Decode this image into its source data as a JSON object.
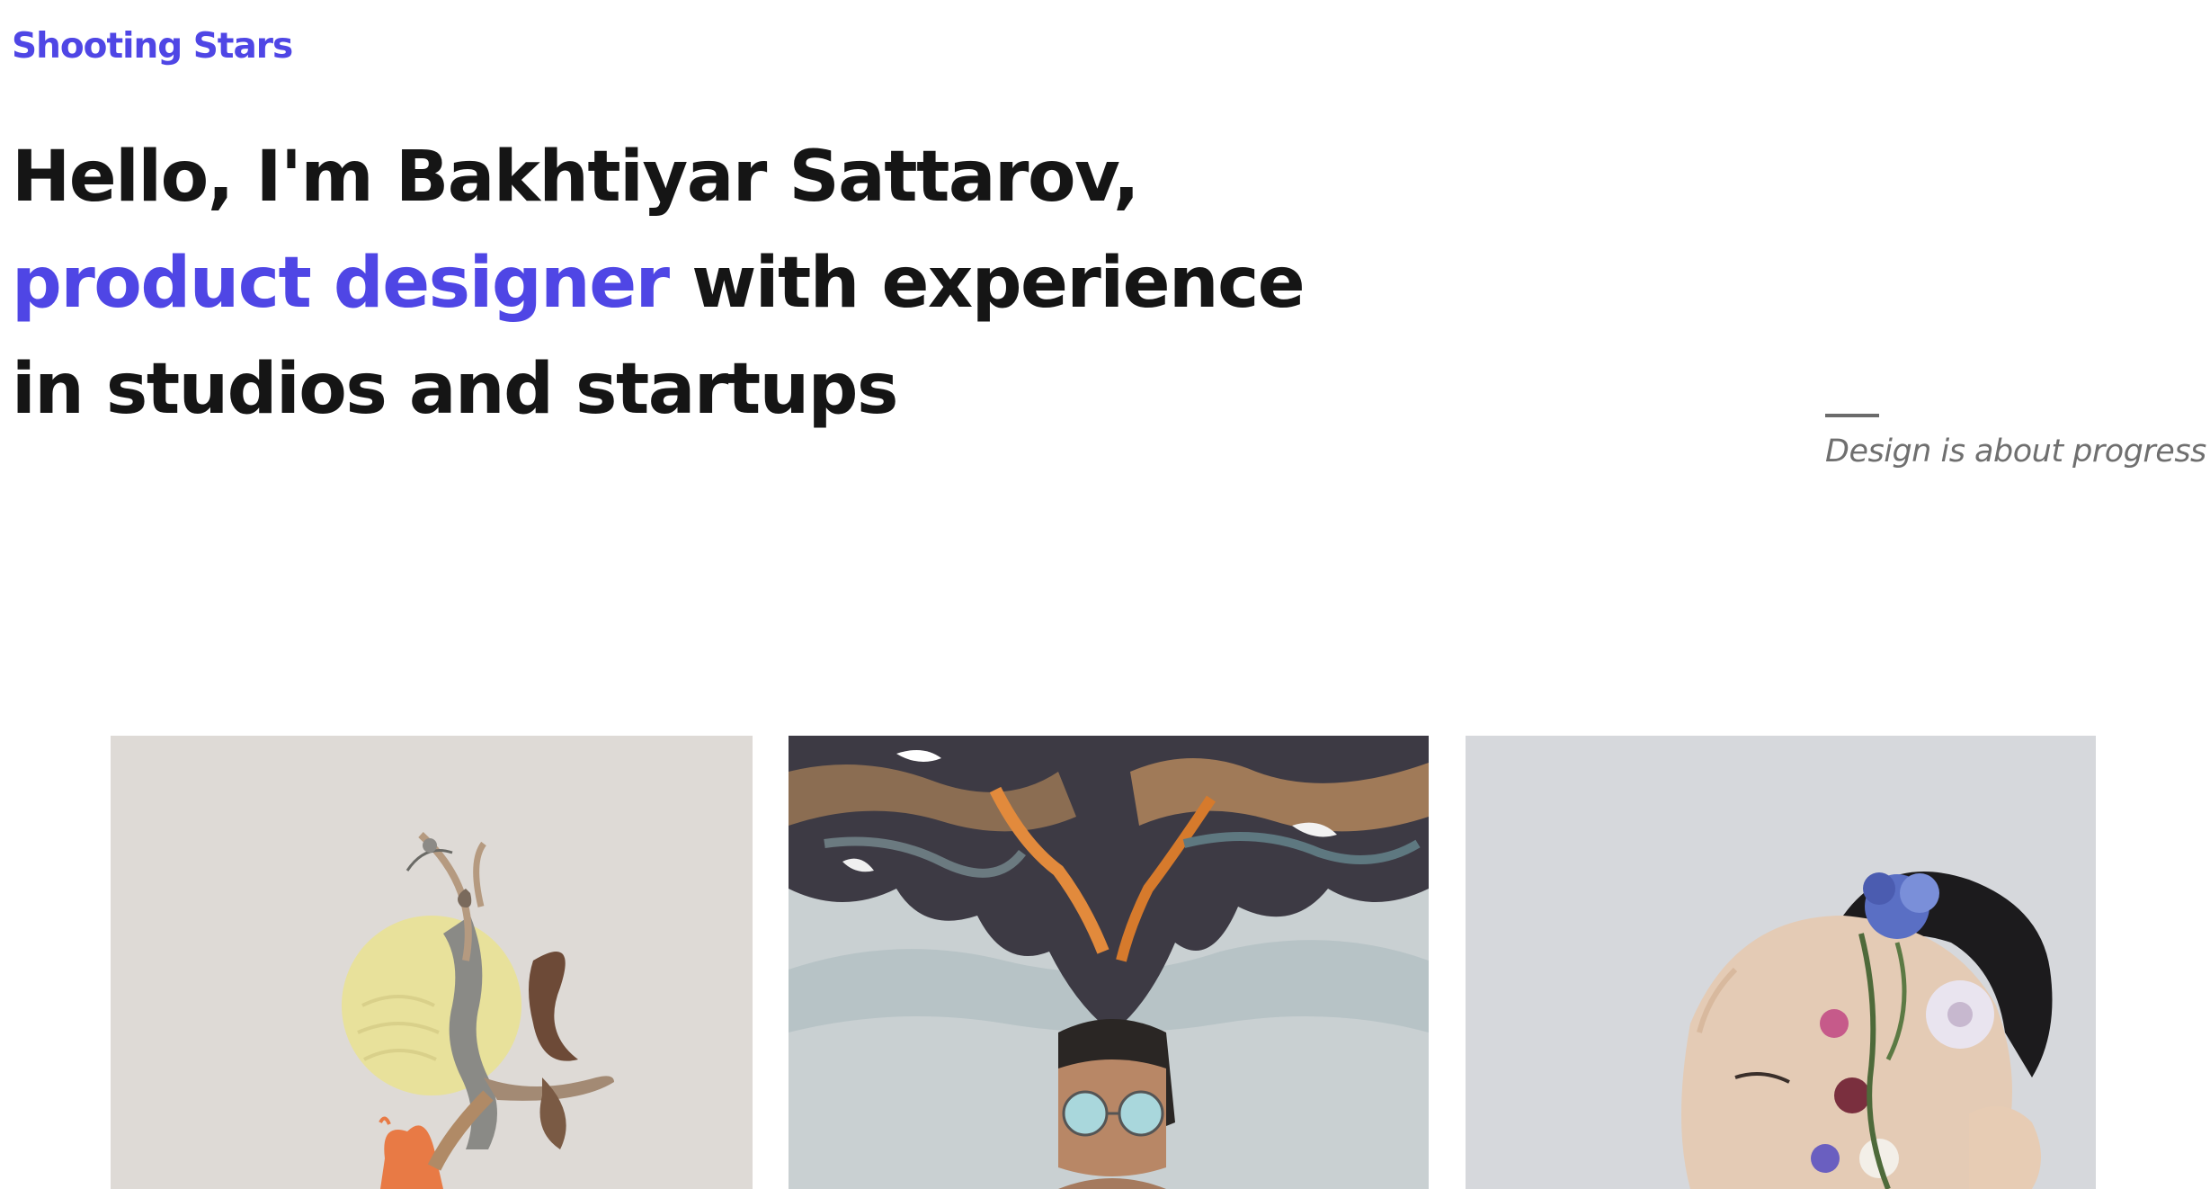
{
  "brand": {
    "name": "Shooting Stars"
  },
  "hero": {
    "line1": "Hello, I'm Bakhtiyar Sattarov,",
    "line2_accent": "product designer",
    "line2_rest": " with experience",
    "line3": "in studios and startups"
  },
  "tagline": {
    "text": "Design is about progress"
  },
  "colors": {
    "accent": "#4f46e5",
    "heading": "#151515",
    "muted": "#6f6f6f"
  },
  "portfolio": {
    "items": [
      {
        "icon": "dancer-collage-image"
      },
      {
        "icon": "surreal-smoke-portrait-image"
      },
      {
        "icon": "flowers-face-portrait-image"
      }
    ]
  }
}
